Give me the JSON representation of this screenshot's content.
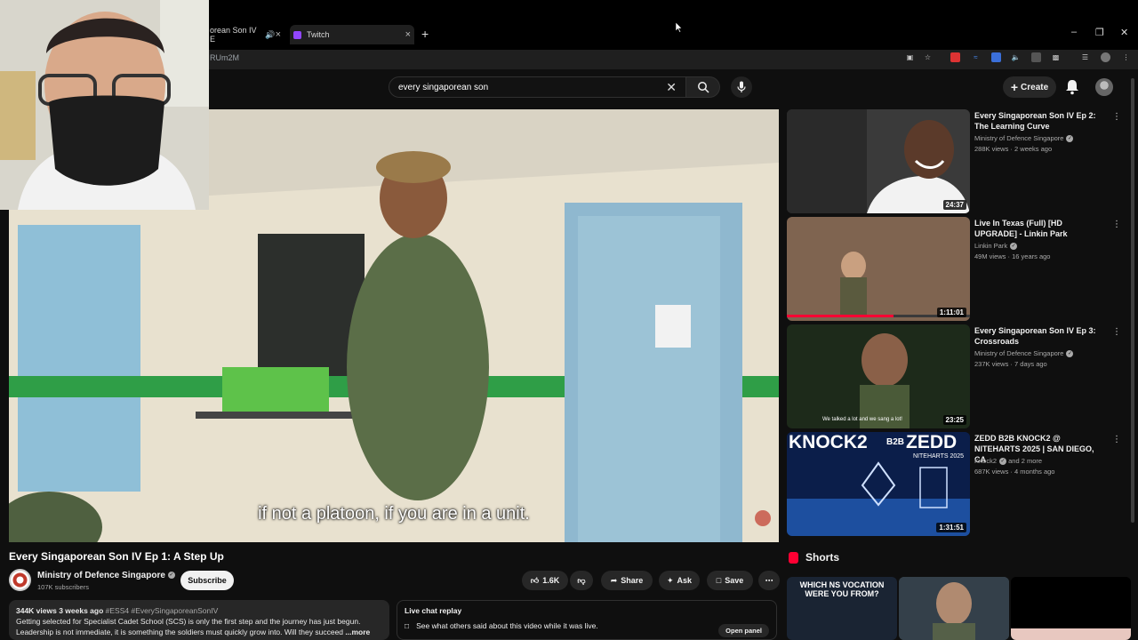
{
  "browser": {
    "tabs": [
      {
        "label": "orean Son IV E",
        "active": false
      },
      {
        "label": "Twitch",
        "active": true
      }
    ],
    "url_fragment": "RUm2M"
  },
  "header": {
    "search_query": "every singaporean son",
    "create_label": "Create"
  },
  "player": {
    "caption": "if not a platoon, if you are in a unit."
  },
  "video": {
    "title": "Every Singaporean Son IV Ep 1: A Step Up",
    "channel": "Ministry of Defence Singapore",
    "subscribers": "107K subscribers",
    "subscribe_label": "Subscribe",
    "like_count": "1.6K",
    "share_label": "Share",
    "ask_label": "Ask",
    "save_label": "Save",
    "stats": "344K views  3 weeks ago",
    "tags": "#ESS4 #EverySingaporeanSonIV",
    "description_line1": "Getting selected for Specialist Cadet School (SCS) is only the first step and the journey has just begun.",
    "description_line2": "Leadership is not immediate, it is something the soldiers must quickly grow into. Will they succeed",
    "more_label": "...more"
  },
  "live_chat": {
    "heading": "Live chat replay",
    "text": "See what others said about this video while it was live.",
    "open_label": "Open panel"
  },
  "recommendations": [
    {
      "title": "Every Singaporean Son IV Ep 2: The Learning Curve",
      "channel": "Ministry of Defence Singapore",
      "verified": true,
      "meta": "288K views · 2 weeks ago",
      "duration": "24:37"
    },
    {
      "title": "Live In Texas (Full) [HD UPGRADE] - Linkin Park",
      "channel": "Linkin Park",
      "verified": true,
      "meta": "49M views · 16 years ago",
      "duration": "1:11:01"
    },
    {
      "title": "Every Singaporean Son IV Ep 3: Crossroads",
      "channel": "Ministry of Defence Singapore",
      "verified": true,
      "meta": "237K views · 7 days ago",
      "duration": "23:25"
    },
    {
      "title": "ZEDD B2B KNOCK2 @ NITEHARTS 2025 | SAN DIEGO, CA",
      "channel": "Knock2",
      "verified": true,
      "channel_suffix": "and 2 more",
      "meta": "687K views · 4 months ago",
      "duration": "1:31:51"
    }
  ],
  "thumb_text": {
    "knock2": "KNOCK2",
    "b2b": "B2B",
    "zedd": "ZEDD",
    "niteharts": "NITEHARTS 2025",
    "ep3_sub": "We talked a lot and we sang a lot!"
  },
  "shorts": {
    "heading": "Shorts",
    "items": [
      {
        "title": "WHICH NS VOCATION WERE YOU FROM?"
      }
    ]
  },
  "colors": {
    "youtube_red": "#ff0033",
    "twitch_purple": "#9146ff",
    "bg": "#0f0f0f"
  }
}
